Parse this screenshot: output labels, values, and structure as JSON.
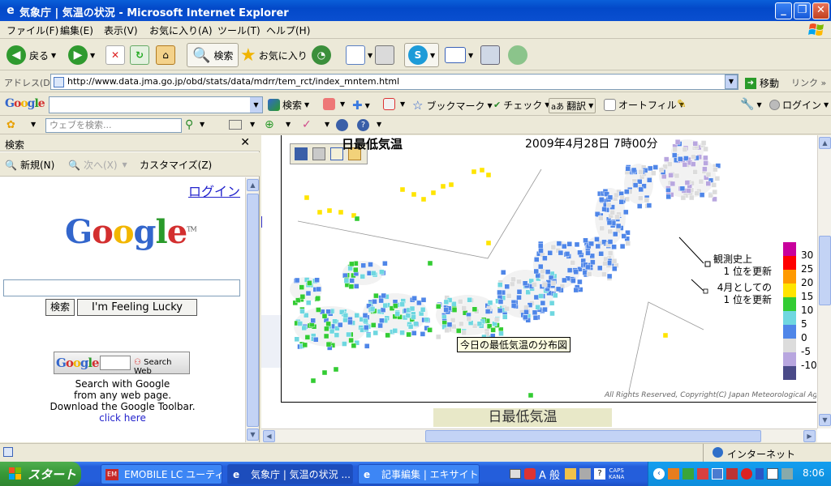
{
  "window": {
    "title": "気象庁 | 気温の状況 - Microsoft Internet Explorer"
  },
  "menu": [
    "ファイル(F)",
    "編集(E)",
    "表示(V)",
    "お気に入り(A)",
    "ツール(T)",
    "ヘルプ(H)"
  ],
  "toolbar": {
    "back": "戻る",
    "search": "検索",
    "favorites": "お気に入り"
  },
  "address": {
    "label": "アドレス(D)",
    "url": "http://www.data.jma.go.jp/obd/stats/data/mdrr/tem_rct/index_mntem.html",
    "go": "移動",
    "links": "リンク"
  },
  "gtoolbar": {
    "logo": "Google",
    "search": "検索",
    "bookmark": "ブックマーク",
    "check": "チェック",
    "translate": "翻訳",
    "autofill": "オートフィル",
    "login": "ログイン"
  },
  "toolbar3": {
    "web_search_placeholder": "ウェブを検索..."
  },
  "searchpane": {
    "title": "検索",
    "new": "新規(N)",
    "next": "次へ(X)",
    "customize": "カスタマイズ(Z)",
    "login_link": "ログイン",
    "logo": "Google",
    "tm": "TM",
    "search_button": "検索",
    "lucky_button": "I'm Feeling Lucky",
    "toolbar_badge_logo": "Google",
    "toolbar_badge_search": "Search Web",
    "promo_line1": "Search with Google",
    "promo_line2": "from any web page.",
    "promo_line3": "Download the Google Toolbar.",
    "promo_link": "click here"
  },
  "map": {
    "title": "日最低気温",
    "datetime": "2009年4月28日  7時00分",
    "legend_note1_line1": "観測史上",
    "legend_note1_line2": "1 位を更新",
    "legend_note2_line1": "4月としての",
    "legend_note2_line2": "1 位を更新",
    "legend_scale": [
      {
        "label": "30",
        "color": "#c8009c"
      },
      {
        "label": "25",
        "color": "#ff0000"
      },
      {
        "label": "20",
        "color": "#ff9900"
      },
      {
        "label": "15",
        "color": "#ffe400"
      },
      {
        "label": "10",
        "color": "#33cc33"
      },
      {
        "label": "5",
        "color": "#6fd7e0"
      },
      {
        "label": "0",
        "color": "#4f86e8"
      },
      {
        "label": "-5",
        "color": "#dcdcdc"
      },
      {
        "label": "-10",
        "color": "#b8a6df"
      }
    ],
    "legend_bottom_color": "#4a4a88",
    "tooltip": "今日の最低気温の分布図",
    "copyright": "All Rights Reserved, Copyright(C) Japan Meteorological Agency",
    "caption": "日最低気温"
  },
  "status": {
    "zone": "インターネット"
  },
  "taskbar": {
    "start": "スタート",
    "items": [
      "EMOBILE LC ユーティ...",
      "気象庁 | 気温の状況 ...",
      "記事編集 | エキサイト..."
    ],
    "ime": "A 般",
    "caps": "CAPS",
    "kana": "KANA",
    "clock": "8:06"
  },
  "colors": {
    "titlebar": "#0a4fd0",
    "taskbar": "#245edb",
    "start": "#379837"
  }
}
